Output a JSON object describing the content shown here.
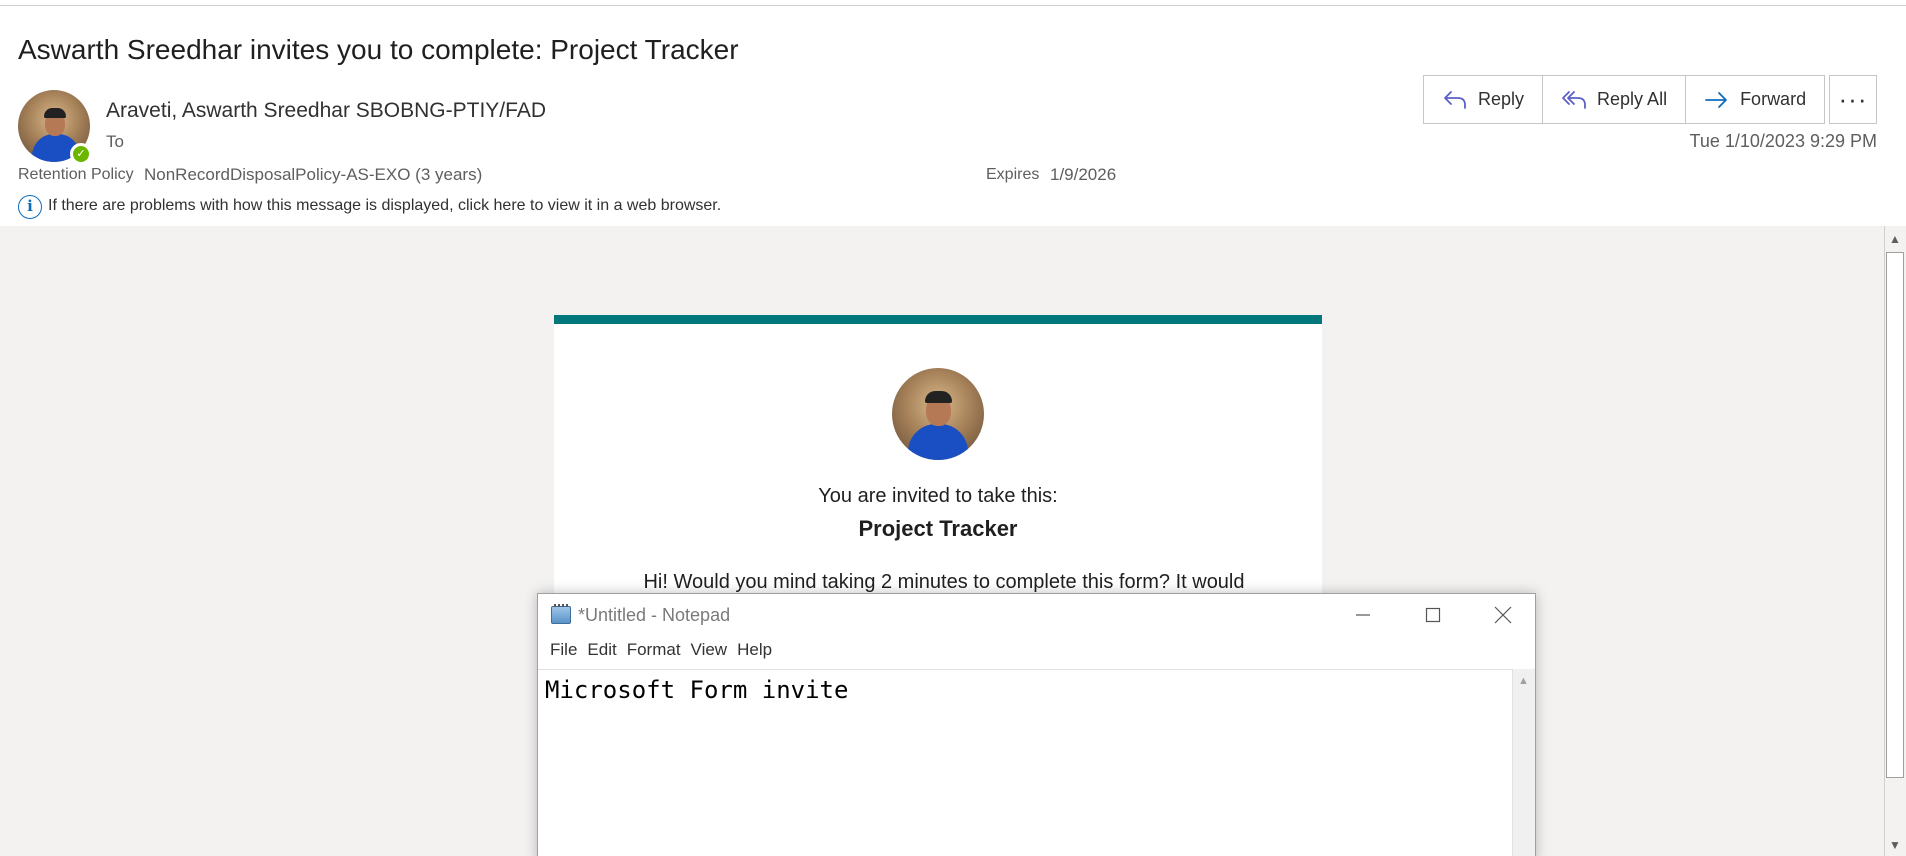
{
  "email": {
    "subject": "Aswarth Sreedhar invites you to complete: Project Tracker",
    "sender_name": "Araveti, Aswarth Sreedhar SBOBNG-PTIY/FAD",
    "to_label": "To",
    "date": "Tue 1/10/2023 9:29 PM",
    "retention_label": "Retention Policy",
    "retention_value": "NonRecordDisposalPolicy-AS-EXO (3 years)",
    "expires_label": "Expires",
    "expires_value": "1/9/2026",
    "info_text": "If there are problems with how this message is displayed, click here to view it in a web browser."
  },
  "actions": {
    "reply": "Reply",
    "reply_all": "Reply All",
    "forward": "Forward",
    "more": "···"
  },
  "card": {
    "invited_text": "You are invited to take this:",
    "form_title": "Project Tracker",
    "message": "Hi! Would you mind taking 2 minutes to complete this form? It would"
  },
  "notepad": {
    "title": "*Untitled - Notepad",
    "menus": [
      "File",
      "Edit",
      "Format",
      "View",
      "Help"
    ],
    "content": "Microsoft Form invite"
  },
  "colors": {
    "accent_teal": "#03787c",
    "presence_green": "#6bb700",
    "link_blue": "#0f6cbd"
  }
}
